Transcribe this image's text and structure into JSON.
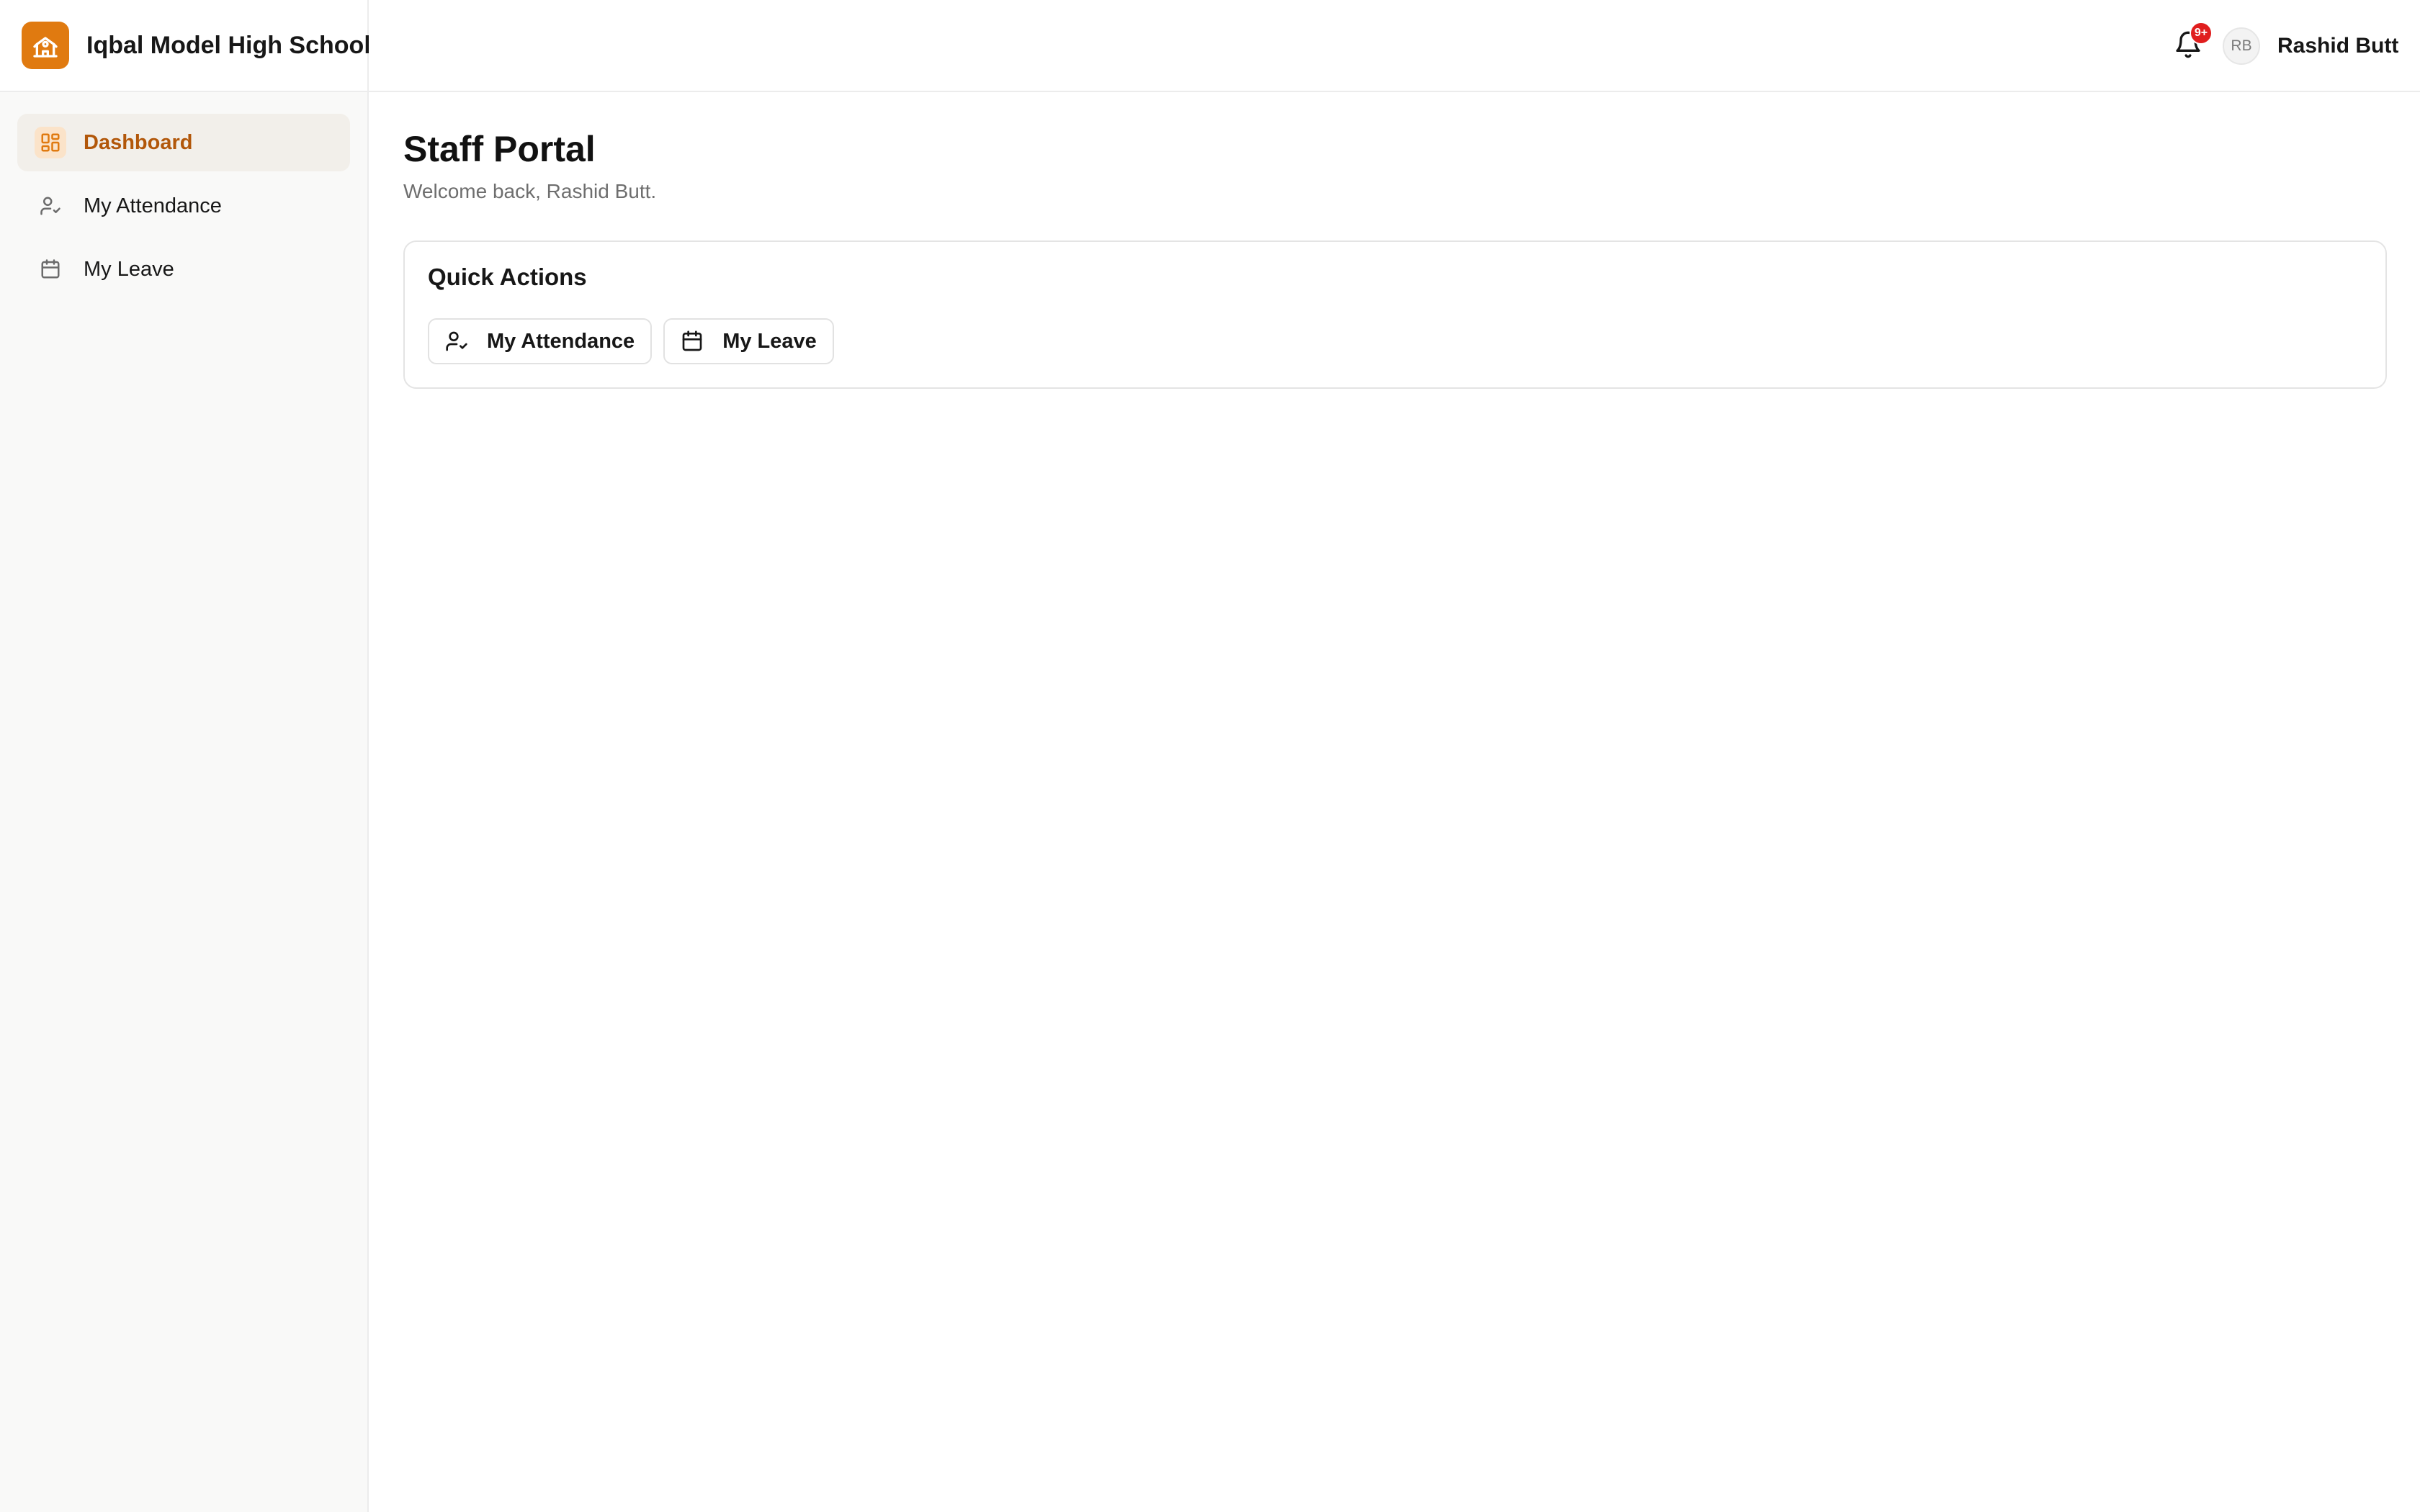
{
  "app": {
    "name": "Iqbal Model High School",
    "logo_icon": "school-icon",
    "accent_color": "#e07a10"
  },
  "sidebar": {
    "items": [
      {
        "label": "Dashboard",
        "icon": "dashboard-grid-icon",
        "active": true
      },
      {
        "label": "My Attendance",
        "icon": "user-check-icon",
        "active": false
      },
      {
        "label": "My Leave",
        "icon": "calendar-icon",
        "active": false
      }
    ]
  },
  "header": {
    "notifications": {
      "icon": "bell-icon",
      "badge": "9+"
    },
    "user": {
      "initials": "RB",
      "name": "Rashid Butt"
    }
  },
  "main": {
    "title": "Staff Portal",
    "subtitle": "Welcome back, Rashid Butt.",
    "quick_actions": {
      "title": "Quick Actions",
      "buttons": [
        {
          "label": "My Attendance",
          "icon": "user-check-icon"
        },
        {
          "label": "My Leave",
          "icon": "calendar-icon"
        }
      ]
    }
  }
}
